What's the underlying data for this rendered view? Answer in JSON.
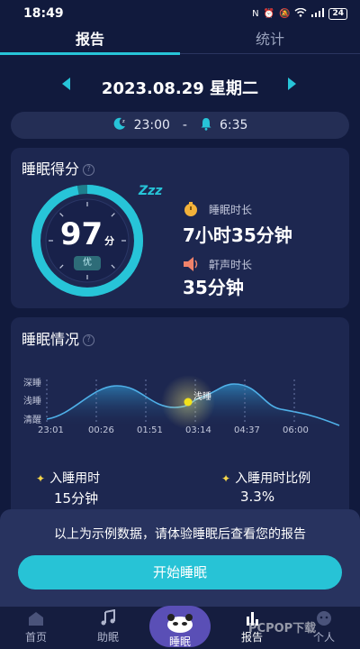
{
  "status_bar": {
    "time": "18:49",
    "battery": "24"
  },
  "tabs": [
    {
      "label": "报告"
    },
    {
      "label": "统计"
    }
  ],
  "date": {
    "text": "2023.08.29  星期二"
  },
  "time_range": {
    "bedtime": "23:00",
    "separator": "-",
    "alarm": "6:35"
  },
  "score_card": {
    "title": "睡眠得分",
    "score": "97",
    "unit": "分",
    "grade": "优",
    "zzz": "Zzz",
    "duration_label": "睡眠时长",
    "duration_value": "7小时35分钟",
    "snore_label": "鼾声时长",
    "snore_value": "35分钟"
  },
  "sleep_card": {
    "title": "睡眠情况",
    "stage_labels": [
      "深睡",
      "浅睡",
      "清醒"
    ],
    "marker_label": "浅睡",
    "time_labels": [
      "23:01",
      "00:26",
      "01:51",
      "03:14",
      "04:37",
      "06:00"
    ],
    "stats": [
      {
        "label": "入睡用时",
        "value": "15分钟"
      },
      {
        "label": "入睡用时比例",
        "value": "3.3%"
      }
    ]
  },
  "overlay": {
    "message": "以上为示例数据，请体验睡眠后查看您的报告",
    "button_label": "开始睡眠"
  },
  "bottom_nav": [
    {
      "label": "首页"
    },
    {
      "label": "助眠"
    },
    {
      "label": "睡眠"
    },
    {
      "label": "报告"
    },
    {
      "label": "个人"
    }
  ],
  "watermark": "PCPOP下载",
  "colors": {
    "accent": "#27c4d8",
    "background": "#111a3d",
    "card": "#1d2750",
    "marker": "#f2e21b"
  }
}
